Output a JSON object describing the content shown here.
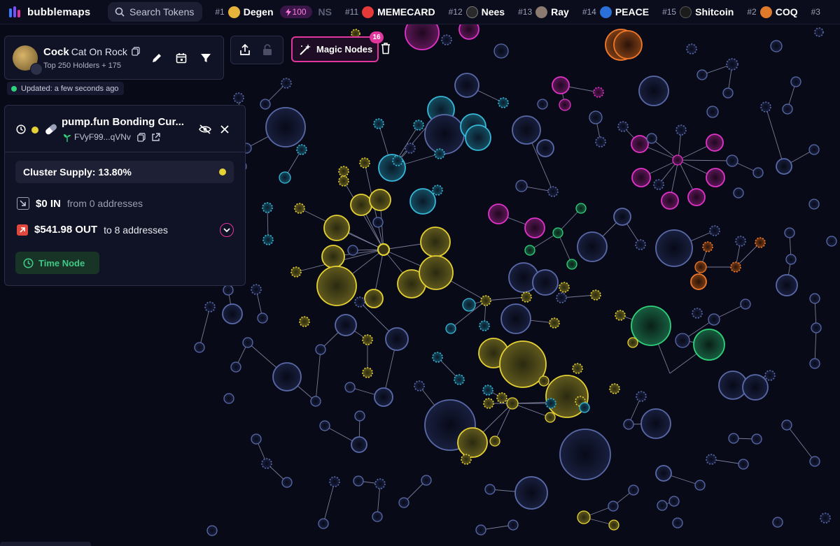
{
  "app": {
    "name": "bubblemaps"
  },
  "search": {
    "label": "Search Tokens"
  },
  "tickers": [
    {
      "rank": "#1",
      "name": "Degen",
      "badge": "100",
      "avatar_color": "#e8b33a"
    },
    {
      "rank": "",
      "name": "NS",
      "avatar_color": ""
    },
    {
      "rank": "#11",
      "name": "MEMECARD",
      "avatar_color": "#e53a3a"
    },
    {
      "rank": "#12",
      "name": "Nees",
      "avatar_color": "#2a2a2a"
    },
    {
      "rank": "#13",
      "name": "Ray",
      "avatar_color": "#8a7a70"
    },
    {
      "rank": "#14",
      "name": "PEACE",
      "avatar_color": "#2b6fd8"
    },
    {
      "rank": "#15",
      "name": "Shitcoin",
      "avatar_color": "#1c1c1c"
    },
    {
      "rank": "#2",
      "name": "COQ",
      "avatar_color": "#e07a2a"
    },
    {
      "rank": "#3",
      "name": "",
      "avatar_color": ""
    }
  ],
  "token": {
    "symbol": "Cock",
    "full_name": "Cat On Rock",
    "subtitle": "Top 250 Holders + 175"
  },
  "status": {
    "updated": "Updated: a few seconds ago"
  },
  "magic_nodes": {
    "label": "Magic Nodes",
    "count": "16"
  },
  "node_info": {
    "title": "pump.fun Bonding Cur...",
    "address": "FVyF99...qVNv",
    "cluster_supply": "Cluster Supply: 13.80%",
    "in_amount": "$0 IN",
    "in_rest": "from 0 addresses",
    "out_amount": "$541.98 OUT",
    "out_rest": "to 8 addresses",
    "time_node_label": "Time Node",
    "cluster_color": "#e5d134"
  },
  "colors": {
    "background": "#080a18",
    "accent_pink": "#e0369e",
    "yellow": "#e5d134",
    "cyan": "#38b8d8",
    "magenta": "#e033c8",
    "green": "#2fd17a",
    "orange": "#f0782a",
    "neutral": "#5a6aa8"
  },
  "icons": [
    "bubblemaps-logo-icon",
    "search-icon",
    "lightning-icon",
    "copy-icon",
    "pencil-icon",
    "calendar-icon",
    "filter-icon",
    "share-icon",
    "lock-icon",
    "magic-wand-icon",
    "trash-icon",
    "clock-icon",
    "pill-icon",
    "seedling-icon",
    "external-link-icon",
    "eye-off-icon",
    "close-icon",
    "arrow-in-icon",
    "arrow-out-icon",
    "chevron-down-icon"
  ]
}
